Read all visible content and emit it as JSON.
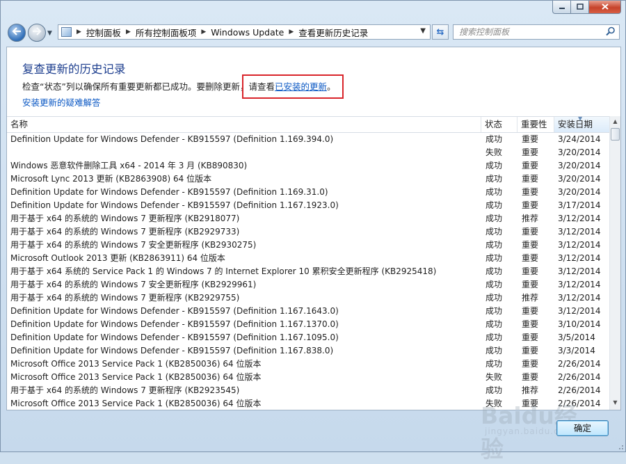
{
  "window": {
    "caption": {
      "minimize_icon": "minimize-icon",
      "maximize_icon": "maximize-icon",
      "close_icon": "close-icon"
    }
  },
  "nav": {
    "back_icon": "back-arrow-icon",
    "forward_icon": "forward-arrow-icon",
    "breadcrumbs": [
      "控制面板",
      "所有控制面板项",
      "Windows Update",
      "查看更新历史记录"
    ],
    "search_placeholder": "搜索控制面板"
  },
  "page": {
    "title": "复查更新的历史记录",
    "desc_prefix": "检查“状态”列以确保所有重要更新都已成功。要删除更新，请查看",
    "desc_link": "已安装的更新",
    "desc_suffix": "。",
    "troubleshoot_link": "安装更新的疑难解答"
  },
  "table": {
    "headers": [
      "名称",
      "状态",
      "重要性",
      "安装日期"
    ],
    "rows": [
      {
        "name": "Definition Update for Windows Defender - KB915597 (Definition 1.169.394.0)",
        "status": "成功",
        "importance": "重要",
        "date": "3/24/2014"
      },
      {
        "name": "",
        "status": "失败",
        "importance": "重要",
        "date": "3/20/2014"
      },
      {
        "name": "Windows 恶意软件删除工具 x64 - 2014 年 3 月 (KB890830)",
        "status": "成功",
        "importance": "重要",
        "date": "3/20/2014"
      },
      {
        "name": "Microsoft Lync 2013 更新 (KB2863908) 64 位版本",
        "status": "成功",
        "importance": "重要",
        "date": "3/20/2014"
      },
      {
        "name": "Definition Update for Windows Defender - KB915597 (Definition 1.169.31.0)",
        "status": "成功",
        "importance": "重要",
        "date": "3/20/2014"
      },
      {
        "name": "Definition Update for Windows Defender - KB915597 (Definition 1.167.1923.0)",
        "status": "成功",
        "importance": "重要",
        "date": "3/17/2014"
      },
      {
        "name": "用于基于 x64 的系统的 Windows 7 更新程序 (KB2918077)",
        "status": "成功",
        "importance": "推荐",
        "date": "3/12/2014"
      },
      {
        "name": "用于基于 x64 的系统的 Windows 7 更新程序 (KB2929733)",
        "status": "成功",
        "importance": "重要",
        "date": "3/12/2014"
      },
      {
        "name": "用于基于 x64 的系统的 Windows 7 安全更新程序 (KB2930275)",
        "status": "成功",
        "importance": "重要",
        "date": "3/12/2014"
      },
      {
        "name": "Microsoft Outlook 2013 更新 (KB2863911) 64 位版本",
        "status": "成功",
        "importance": "重要",
        "date": "3/12/2014"
      },
      {
        "name": "用于基于 x64 系统的 Service Pack 1 的 Windows 7 的 Internet Explorer 10 累积安全更新程序 (KB2925418)",
        "status": "成功",
        "importance": "重要",
        "date": "3/12/2014"
      },
      {
        "name": "用于基于 x64 的系统的 Windows 7 安全更新程序 (KB2929961)",
        "status": "成功",
        "importance": "重要",
        "date": "3/12/2014"
      },
      {
        "name": "用于基于 x64 的系统的 Windows 7 更新程序 (KB2929755)",
        "status": "成功",
        "importance": "推荐",
        "date": "3/12/2014"
      },
      {
        "name": "Definition Update for Windows Defender - KB915597 (Definition 1.167.1643.0)",
        "status": "成功",
        "importance": "重要",
        "date": "3/12/2014"
      },
      {
        "name": "Definition Update for Windows Defender - KB915597 (Definition 1.167.1370.0)",
        "status": "成功",
        "importance": "重要",
        "date": "3/10/2014"
      },
      {
        "name": "Definition Update for Windows Defender - KB915597 (Definition 1.167.1095.0)",
        "status": "成功",
        "importance": "重要",
        "date": "3/5/2014"
      },
      {
        "name": "Definition Update for Windows Defender - KB915597 (Definition 1.167.838.0)",
        "status": "成功",
        "importance": "重要",
        "date": "3/3/2014"
      },
      {
        "name": "Microsoft Office 2013 Service Pack 1 (KB2850036) 64 位版本",
        "status": "成功",
        "importance": "重要",
        "date": "2/26/2014"
      },
      {
        "name": "Microsoft Office 2013 Service Pack 1 (KB2850036) 64 位版本",
        "status": "失败",
        "importance": "重要",
        "date": "2/26/2014"
      },
      {
        "name": "用于基于 x64 的系统的 Windows 7 更新程序 (KB2923545)",
        "status": "成功",
        "importance": "推荐",
        "date": "2/26/2014"
      },
      {
        "name": "Microsoft Office 2013 Service Pack 1 (KB2850036) 64 位版本",
        "status": "失败",
        "importance": "重要",
        "date": "2/26/2014"
      }
    ]
  },
  "footer": {
    "ok_label": "确定"
  },
  "watermark": {
    "logo": "Baidu经验",
    "url": "jingyan.baidu.com"
  },
  "colors": {
    "title": "#1e3f8f",
    "link": "#0b58c4",
    "highlight": "#d9242a"
  }
}
